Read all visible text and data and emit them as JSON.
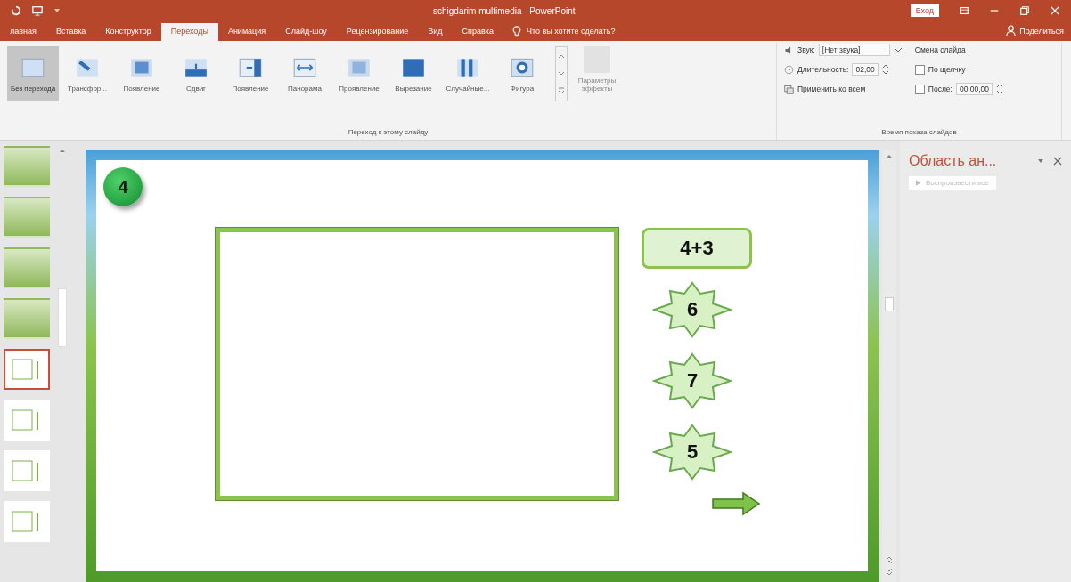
{
  "window": {
    "title": "schigdarim multimedia - PowerPoint",
    "sign_in": "Вход"
  },
  "ribbon_tabs": [
    {
      "label": "лавная",
      "selected": false
    },
    {
      "label": "Вставка",
      "selected": false
    },
    {
      "label": "Конструктор",
      "selected": false
    },
    {
      "label": "Переходы",
      "selected": true
    },
    {
      "label": "Анимация",
      "selected": false
    },
    {
      "label": "Слайд-шоу",
      "selected": false
    },
    {
      "label": "Рецензирование",
      "selected": false
    },
    {
      "label": "Вид",
      "selected": false
    },
    {
      "label": "Справка",
      "selected": false
    }
  ],
  "tell_me": "Что вы хотите сделать?",
  "share": "Поделиться",
  "transitions": {
    "items": [
      {
        "label": "Без перехода",
        "selected": true
      },
      {
        "label": "Трансфор...",
        "selected": false
      },
      {
        "label": "Появление",
        "selected": false
      },
      {
        "label": "Сдвиг",
        "selected": false
      },
      {
        "label": "Появление",
        "selected": false
      },
      {
        "label": "Панорама",
        "selected": false
      },
      {
        "label": "Проявление",
        "selected": false
      },
      {
        "label": "Вырезание",
        "selected": false
      },
      {
        "label": "Случайные...",
        "selected": false
      },
      {
        "label": "Фигура",
        "selected": false
      }
    ],
    "effect_options": {
      "label": "Параметры эффекты",
      "disabled": true
    },
    "group_label": "Переход к этому слайду"
  },
  "timing": {
    "sound_label": "Звук:",
    "sound_value": "[Нет звука]",
    "duration_label": "Длительность:",
    "duration_value": "02,00",
    "apply_all": "Применить ко всем",
    "advance_title": "Смена слайда",
    "on_click": {
      "label": "По щелчку",
      "checked": false
    },
    "after": {
      "label": "После:",
      "checked": false,
      "value": "00:00,00"
    },
    "group_label": "Время показа слайдов"
  },
  "thumbnails": [
    {
      "kind": "picture",
      "selected": false
    },
    {
      "kind": "picture",
      "selected": false
    },
    {
      "kind": "picture",
      "selected": false
    },
    {
      "kind": "picture",
      "selected": false
    },
    {
      "kind": "layout",
      "selected": true
    },
    {
      "kind": "layout",
      "selected": false
    },
    {
      "kind": "layout",
      "selected": false
    },
    {
      "kind": "layout",
      "selected": false
    }
  ],
  "slide": {
    "badge": "4",
    "expression": "4+3",
    "answers": [
      "6",
      "7",
      "5"
    ]
  },
  "animation_pane": {
    "title": "Область ан...",
    "play_all": {
      "label": "Воспроизвести все",
      "disabled": true
    }
  }
}
